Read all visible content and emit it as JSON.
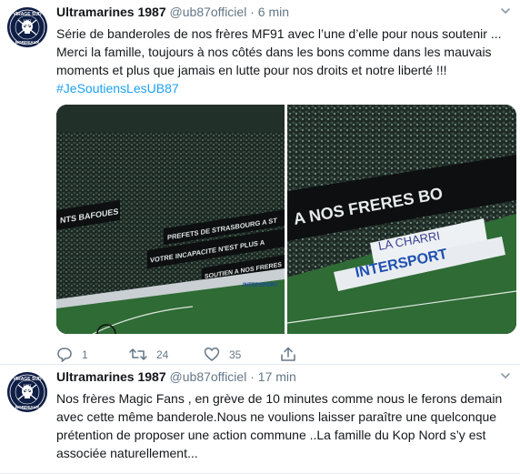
{
  "tweets": [
    {
      "avatar": {
        "top_text": "VIRAGE SUD",
        "number": "1987",
        "bottom_text": "BORDEAUX"
      },
      "name": "Ultramarines 1987",
      "handle": "@ub87officiel",
      "separator": "·",
      "time": "6 min",
      "text": "Série de banderoles de nos frères MF91 avec l’une d’elle pour nous soutenir ... Merci la famille, toujours à nos côtés dans les bons comme dans les mauvais moments et plus que jamais en lutte pour nos droits et notre liberté !!!",
      "hashtag": "#JeSoutiensLesUB87",
      "media": {
        "left_banners": [
          "NTS BAFOUES",
          "PREFETS DE STRASBOURG A ST",
          "VOTRE INCAPACITE N'EST PLUS A",
          "SOUTIEN A NOS FRERES"
        ],
        "left_board": "INTERSPORT",
        "right_banner": "A NOS FRERES BO",
        "right_board_top": "LA CHARRI",
        "right_board_bottom": "INTERSPORT",
        "colors": {
          "pitch": "#2f6b35",
          "crowd": "#1b2a24",
          "banner": "#0d0f10"
        }
      },
      "actions": {
        "reply": "1",
        "retweet": "24",
        "like": "35"
      },
      "colors": {
        "name": "#14171a",
        "meta": "#657786",
        "link": "#1da1f2"
      }
    },
    {
      "avatar": {
        "top_text": "VIRAGE SUD",
        "number": "1987",
        "bottom_text": "BORDEAUX"
      },
      "name": "Ultramarines 1987",
      "handle": "@ub87officiel",
      "separator": "·",
      "time": "17 min",
      "text": "Nos frères Magic Fans , en grève de 10 minutes comme nous le ferons demain avec cette même banderole.Nous ne voulions laisser paraître une quelconque prétention de proposer une action commune ..La famille du Kop Nord s’y est associée naturellement..."
    }
  ]
}
